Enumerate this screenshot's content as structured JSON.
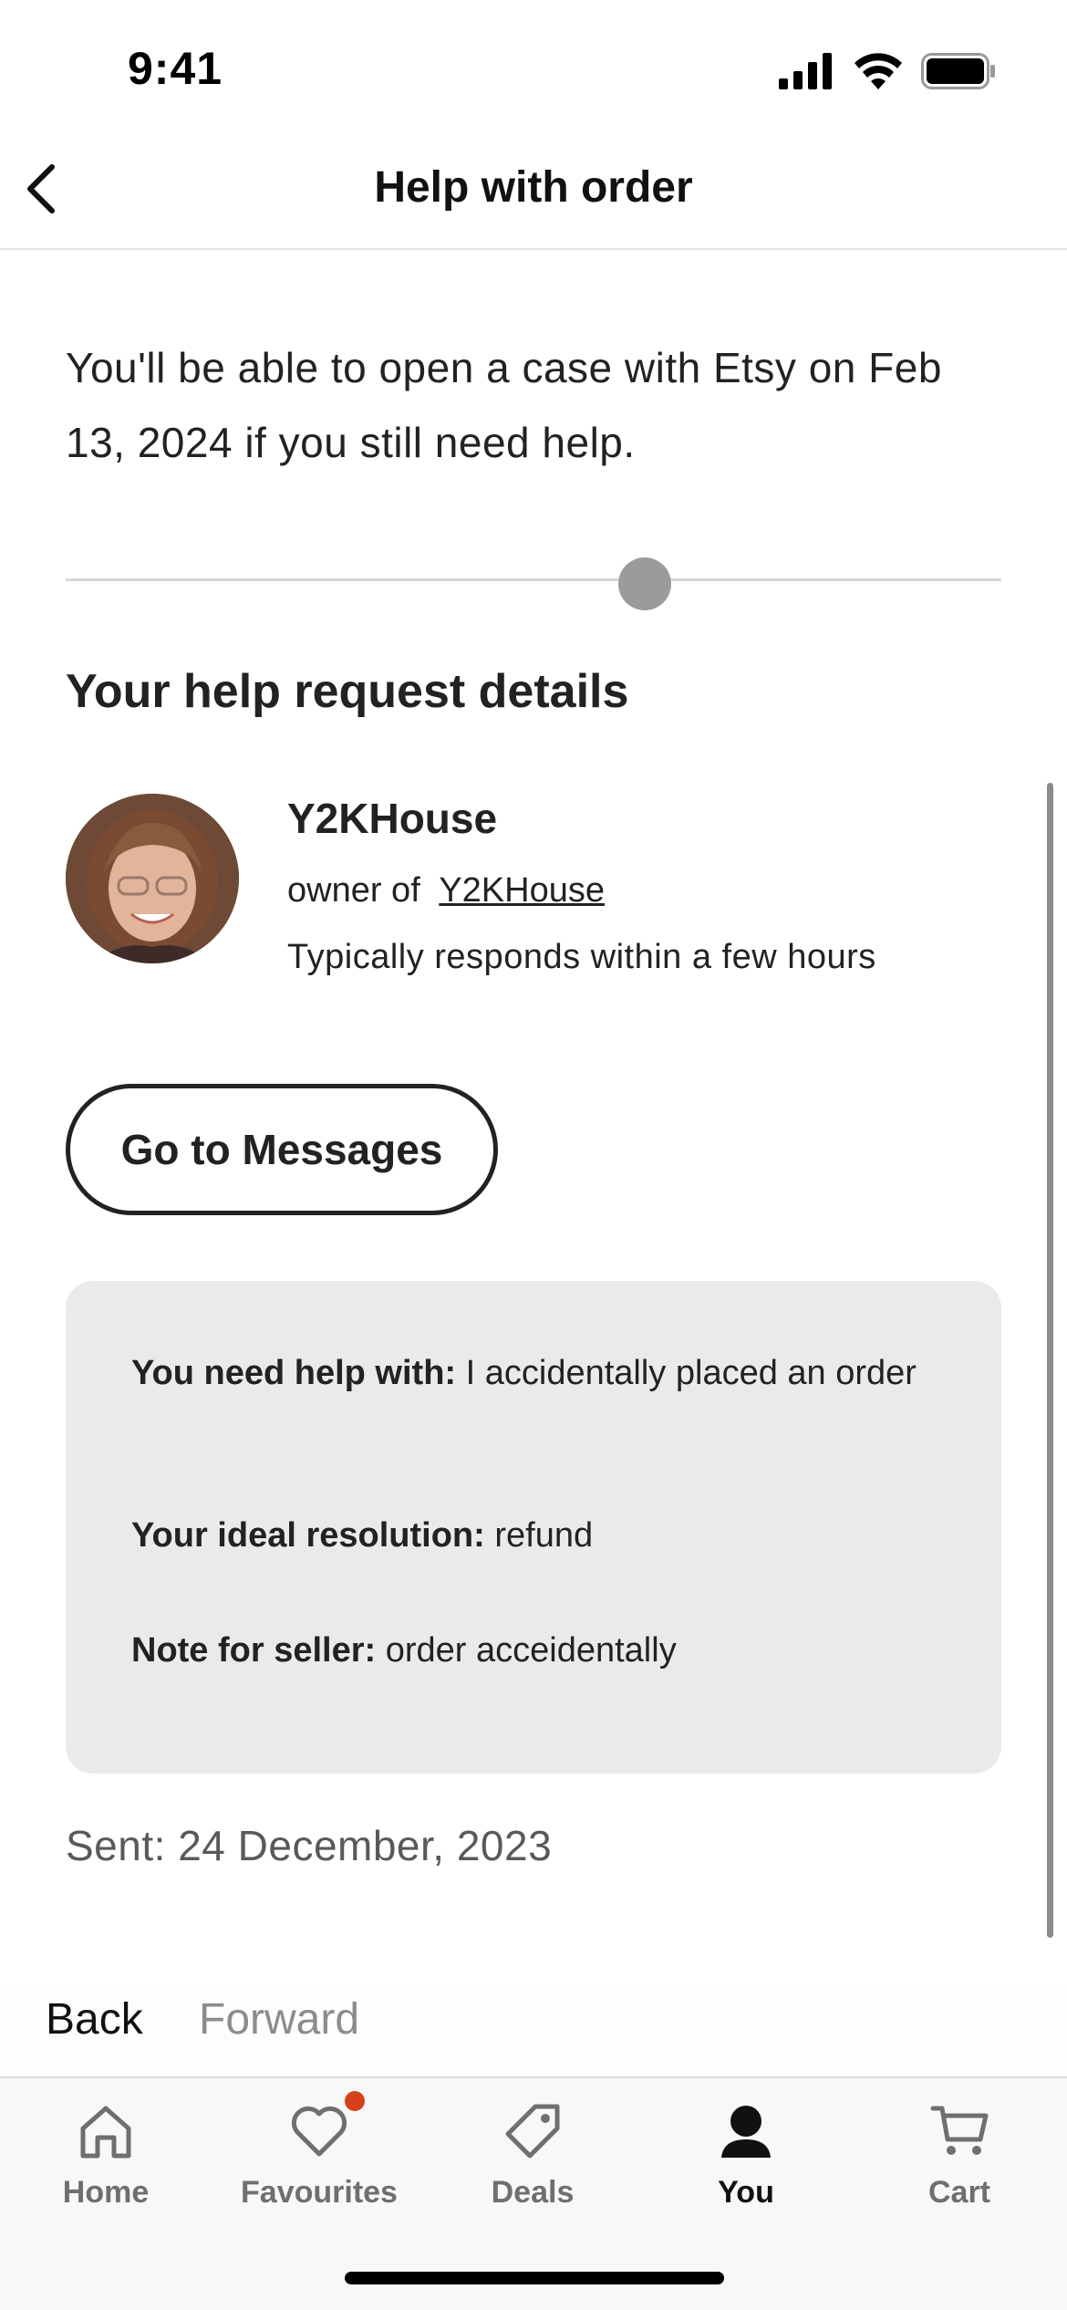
{
  "status_bar": {
    "time": "9:41"
  },
  "header": {
    "title": "Help with order"
  },
  "info": {
    "text": "You'll be able to open a case with Etsy on Feb 13, 2024 if you still need help."
  },
  "section": {
    "heading": "Your help request details"
  },
  "seller": {
    "name": "Y2KHouse",
    "owner_prefix": "owner of",
    "shop_link": "Y2KHouse",
    "response_time": "Typically responds within a few hours"
  },
  "actions": {
    "messages_button": "Go to Messages"
  },
  "details": {
    "help_label": "You need help with:",
    "help_value": "I accidentally placed an order",
    "resolution_label": "Your ideal resolution:",
    "resolution_value": "refund",
    "note_label": "Note for seller:",
    "note_value": "order acceidentally"
  },
  "sent": "Sent: 24 December, 2023",
  "browser_nav": {
    "back": "Back",
    "forward": "Forward"
  },
  "tabs": [
    {
      "label": "Home",
      "icon": "home-icon"
    },
    {
      "label": "Favourites",
      "icon": "heart-icon"
    },
    {
      "label": "Deals",
      "icon": "tag-icon"
    },
    {
      "label": "You",
      "icon": "person-icon"
    },
    {
      "label": "Cart",
      "icon": "cart-icon"
    }
  ],
  "colors": {
    "notification": "#d6411c",
    "card_bg": "#ebeaeb"
  }
}
